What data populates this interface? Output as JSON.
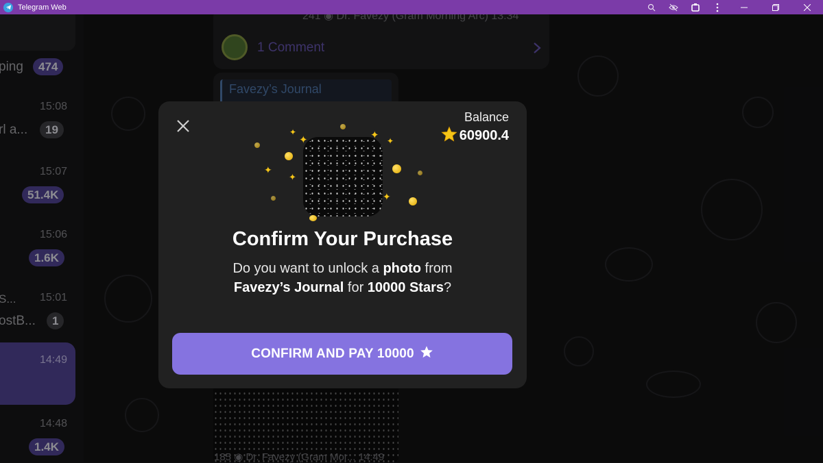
{
  "window": {
    "title": "Telegram Web"
  },
  "sidebar": {
    "rows": [
      {
        "text": "ping",
        "badge": "474"
      },
      {
        "time": "15:08",
        "text": "rl a...",
        "badge": "19"
      },
      {
        "time": "15:07",
        "badge": "51.4K"
      },
      {
        "time": "15:06",
        "badge": "1.6K"
      },
      {
        "time": "15:01",
        "text_top": "S...",
        "text": "ostB...",
        "badge": "1"
      },
      {
        "time": "14:49"
      },
      {
        "time": "14:48",
        "badge": "1.4K"
      }
    ]
  },
  "chat": {
    "post_meta": "241 ◉ Dr. Favezy (Gram Morning Arc) 13:34",
    "comments_label": "1 Comment",
    "quoted_channel": "Favezy’s Journal",
    "bottom_caption": "185 ◉ Dr. Favezy (Gram Mor... 14:49"
  },
  "modal": {
    "balance_label": "Balance",
    "balance_value": "60900.4",
    "title": "Confirm Your Purchase",
    "desc_part1": "Do you want to unlock a ",
    "desc_media": "photo",
    "desc_part2": " from",
    "desc_channel": "Favezy’s Journal",
    "desc_part3": " for ",
    "desc_amount": "10000 Stars",
    "desc_part4": "?",
    "pay_button_label": "CONFIRM AND PAY 10000"
  },
  "colors": {
    "titlebar": "#7b3ba8",
    "accent": "#8573e0",
    "modal_bg": "#212121",
    "star": "#f5c518"
  },
  "icons": [
    "telegram-icon",
    "zoom-icon",
    "eye-off-icon",
    "extension-icon",
    "more-icon",
    "minimize-icon",
    "maximize-icon",
    "close-window-icon",
    "close-icon",
    "star-icon",
    "sparkle-icon",
    "coin-icon"
  ]
}
